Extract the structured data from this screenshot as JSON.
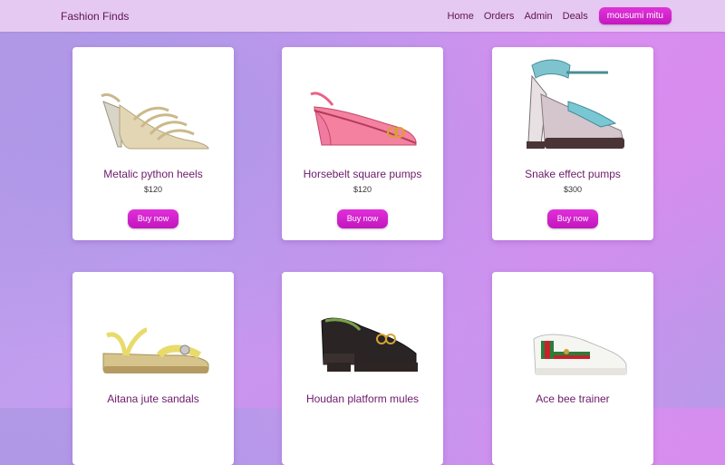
{
  "nav": {
    "brand": "Fashion Finds",
    "links": [
      "Home",
      "Orders",
      "Admin",
      "Deals"
    ],
    "user": "mousumi mitu"
  },
  "products": [
    {
      "name": "Metalic python heels",
      "price": "$120",
      "button": "Buy now",
      "icon": "metallic-heel-sandal"
    },
    {
      "name": "Horsebelt square pumps",
      "price": "$120",
      "button": "Buy now",
      "icon": "pink-slingback-pump"
    },
    {
      "name": "Snake effect pumps",
      "price": "$300",
      "button": "Buy now",
      "icon": "snake-platform-pump"
    },
    {
      "name": "Aitana jute sandals",
      "price": "",
      "button": "",
      "icon": "flat-jute-sandal"
    },
    {
      "name": "Houdan platform mules",
      "price": "",
      "button": "",
      "icon": "black-platform-mule"
    },
    {
      "name": "Ace bee trainer",
      "price": "",
      "button": "",
      "icon": "white-sneaker"
    }
  ],
  "colors": {
    "navbar": "#e6c9f2",
    "brand_text": "#5e1553",
    "accent_button": "#d21fcc",
    "product_name": "#6d1a6a"
  }
}
